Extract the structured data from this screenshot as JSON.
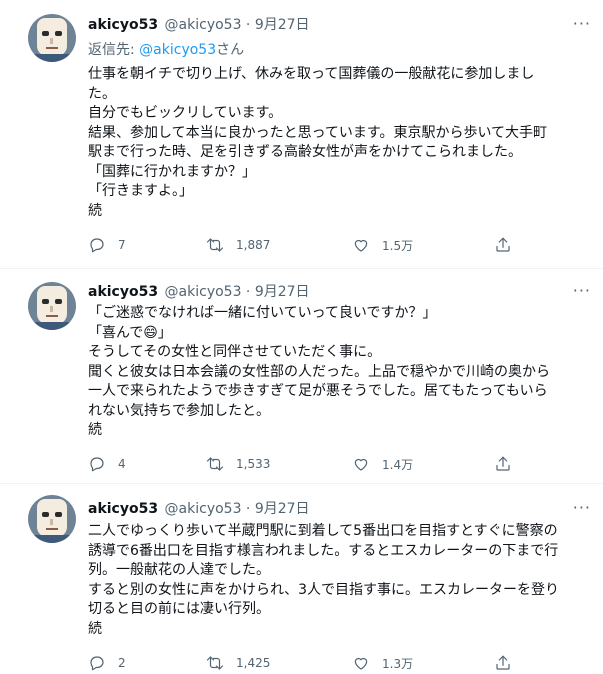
{
  "tweets": [
    {
      "display_name": "akicyo53",
      "meta": "@akicyo53 · 9月27日",
      "reply_prefix": "返信先: ",
      "reply_mention": "@akicyo53",
      "reply_suffix": "さん",
      "text": "仕事を朝イチで切り上げ、休みを取って国葬儀の一般献花に参加しまし\nた。\n自分でもビックリしています。\n結果、参加して本当に良かったと思っています。東京駅から歩いて大手町\n駅まで行った時、足を引きずる高齢女性が声をかけてこられました。\n「国葬に行かれますか？」\n「行きますよ。」\n続",
      "replies": "7",
      "retweets": "1,887",
      "likes": "1.5万"
    },
    {
      "display_name": "akicyo53",
      "meta": "@akicyo53 · 9月27日",
      "text": "「ご迷惑でなければ一緒に付いていって良いですか？」\n「喜んで😄」\nそうしてその女性と同伴させていただく事に。\n聞くと彼女は日本会議の女性部の人だった。上品で穏やかで川崎の奥から\n一人で来られたようで歩きすぎて足が悪そうでした。居てもたってもいら\nれない気持ちで参加したと。\n続",
      "replies": "4",
      "retweets": "1,533",
      "likes": "1.4万"
    },
    {
      "display_name": "akicyo53",
      "meta": "@akicyo53 · 9月27日",
      "text": "二人でゆっくり歩いて半蔵門駅に到着して5番出口を目指すとすぐに警察の\n誘導で6番出口を目指す様言われました。するとエスカレーターの下まで行\n列。一般献花の人達でした。\nすると別の女性に声をかけられ、3人で目指す事に。エスカレーターを登り\n切ると目の前には凄い行列。\n続",
      "replies": "2",
      "retweets": "1,425",
      "likes": "1.3万"
    }
  ],
  "more_label": "···",
  "icons": [
    "reply-icon",
    "retweet-icon",
    "like-icon",
    "share-icon"
  ],
  "colors": {
    "accent": "#1d9bf0",
    "muted": "#536471",
    "text": "#0f1419"
  }
}
